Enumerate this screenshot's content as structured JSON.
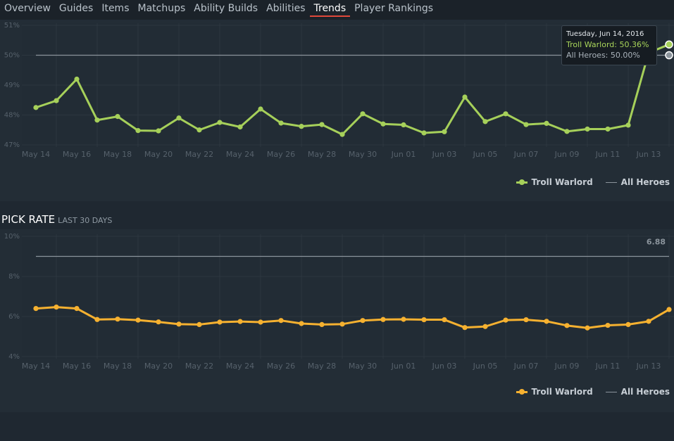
{
  "nav": {
    "tabs": [
      {
        "label": "Overview"
      },
      {
        "label": "Guides"
      },
      {
        "label": "Items"
      },
      {
        "label": "Matchups"
      },
      {
        "label": "Ability Builds"
      },
      {
        "label": "Abilities"
      },
      {
        "label": "Trends",
        "active": true
      },
      {
        "label": "Player Rankings"
      }
    ]
  },
  "colors": {
    "win_series": "#a6d05a",
    "pick_series": "#f6b130",
    "reference_line": "#8b949c",
    "active_tab_underline": "#e0483a"
  },
  "pick_section": {
    "title": "PICK RATE",
    "subtitle": "LAST 30 DAYS"
  },
  "tooltip": {
    "date": "Tuesday, Jun 14, 2016",
    "troll": "Troll Warlord: 50.36%",
    "all": "All Heroes: 50.00%"
  },
  "legend": {
    "troll": "Troll Warlord",
    "all": "All Heroes"
  },
  "chart_data": [
    {
      "type": "line",
      "x_tick_labels": [
        "May 14",
        "May 16",
        "May 18",
        "May 20",
        "May 22",
        "May 24",
        "May 26",
        "May 28",
        "May 30",
        "Jun 01",
        "Jun 03",
        "Jun 05",
        "Jun 07",
        "Jun 09",
        "Jun 11",
        "Jun 13"
      ],
      "y_tick_labels": [
        "47%",
        "48%",
        "49%",
        "50%",
        "51%"
      ],
      "ylim": [
        47,
        51
      ],
      "grid": true,
      "legend_position": "bottom-right",
      "series": [
        {
          "name": "Troll Warlord",
          "values": [
            48.25,
            48.48,
            49.2,
            47.83,
            47.95,
            47.48,
            47.47,
            47.9,
            47.5,
            47.75,
            47.6,
            48.2,
            47.73,
            47.62,
            47.68,
            47.35,
            48.04,
            47.7,
            47.67,
            47.4,
            47.44,
            48.6,
            47.78,
            48.04,
            47.68,
            47.72,
            47.45,
            47.53,
            47.53,
            47.66,
            50.08,
            50.36
          ]
        },
        {
          "name": "All Heroes",
          "values": [
            50.0,
            50.0,
            50.0,
            50.0,
            50.0,
            50.0,
            50.0,
            50.0,
            50.0,
            50.0,
            50.0,
            50.0,
            50.0,
            50.0,
            50.0,
            50.0,
            50.0,
            50.0,
            50.0,
            50.0,
            50.0,
            50.0,
            50.0,
            50.0,
            50.0,
            50.0,
            50.0,
            50.0,
            50.0,
            50.0,
            50.0,
            50.0
          ]
        }
      ]
    },
    {
      "type": "line",
      "x_tick_labels": [
        "May 14",
        "May 16",
        "May 18",
        "May 20",
        "May 22",
        "May 24",
        "May 26",
        "May 28",
        "May 30",
        "Jun 01",
        "Jun 03",
        "Jun 05",
        "Jun 07",
        "Jun 09",
        "Jun 11",
        "Jun 13"
      ],
      "y_tick_labels": [
        "4%",
        "6%",
        "8%",
        "10%"
      ],
      "ylim": [
        4,
        10
      ],
      "grid": true,
      "legend_position": "bottom-right",
      "reference_label": "6.88",
      "series": [
        {
          "name": "Troll Warlord",
          "values": [
            6.4,
            6.47,
            6.4,
            5.85,
            5.87,
            5.82,
            5.73,
            5.62,
            5.6,
            5.72,
            5.75,
            5.72,
            5.8,
            5.65,
            5.6,
            5.62,
            5.8,
            5.85,
            5.86,
            5.84,
            5.84,
            5.45,
            5.5,
            5.82,
            5.84,
            5.76,
            5.55,
            5.43,
            5.56,
            5.6,
            5.76,
            6.35
          ]
        },
        {
          "name": "All Heroes",
          "values": [
            9.0,
            9.0,
            9.0,
            9.0,
            9.0,
            9.0,
            9.0,
            9.0,
            9.0,
            9.0,
            9.0,
            9.0,
            9.0,
            9.0,
            9.0,
            9.0,
            9.0,
            9.0,
            9.0,
            9.0,
            9.0,
            9.0,
            9.0,
            9.0,
            9.0,
            9.0,
            9.0,
            9.0,
            9.0,
            9.0,
            9.0,
            9.0
          ]
        }
      ]
    }
  ]
}
